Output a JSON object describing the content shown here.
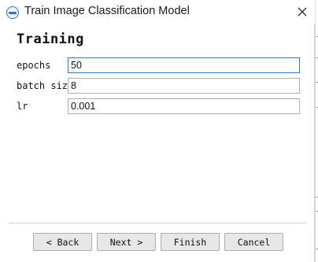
{
  "window": {
    "title": "Train Image Classification Model",
    "app_icon": "app-logo-icon",
    "close_icon": "close-icon"
  },
  "page": {
    "heading": "Training"
  },
  "fields": [
    {
      "label": "epochs",
      "value": "50"
    },
    {
      "label": "batch size",
      "value": "8"
    },
    {
      "label": "lr",
      "value": "0.001"
    }
  ],
  "buttons": {
    "back": "< Back",
    "next": "Next >",
    "finish": "Finish",
    "cancel": "Cancel"
  },
  "colors": {
    "focus_border": "#2b7bd1",
    "button_bg": "#e7e7e7"
  }
}
